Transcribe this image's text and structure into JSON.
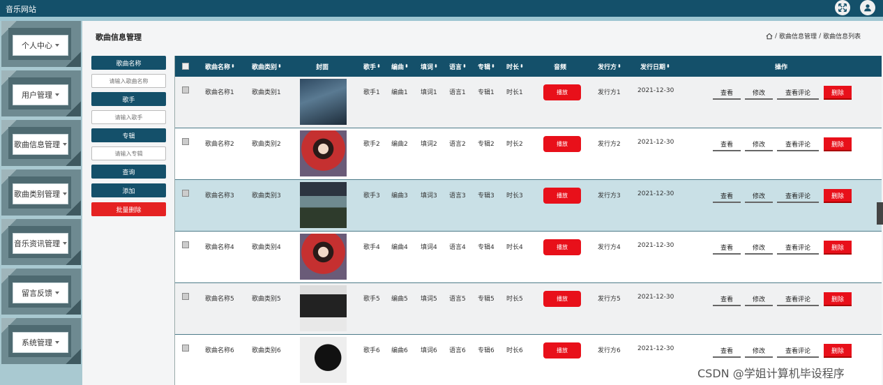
{
  "app": {
    "title": "音乐网站"
  },
  "sidebar": {
    "items": [
      {
        "label": "个人中心"
      },
      {
        "label": "用户管理"
      },
      {
        "label": "歌曲信息管理"
      },
      {
        "label": "歌曲类别管理"
      },
      {
        "label": "音乐资讯管理"
      },
      {
        "label": "留言反馈"
      },
      {
        "label": "系统管理"
      }
    ]
  },
  "page": {
    "title": "歌曲信息管理",
    "breadcrumb": {
      "section": "歌曲信息管理",
      "current": "歌曲信息列表",
      "sep": "/"
    }
  },
  "search": {
    "name_label": "歌曲名称",
    "name_placeholder": "请输入歌曲名称",
    "singer_label": "歌手",
    "singer_placeholder": "请输入歌手",
    "album_label": "专辑",
    "album_placeholder": "请输入专辑",
    "query_btn": "查询",
    "add_btn": "添加",
    "batch_delete_btn": "批量删除"
  },
  "table": {
    "headers": {
      "name": "歌曲名称",
      "category": "歌曲类别",
      "cover": "封面",
      "singer": "歌手",
      "composer": "编曲",
      "lyricist": "填词",
      "language": "语言",
      "album": "专辑",
      "duration": "时长",
      "audio": "音频",
      "publisher": "发行方",
      "date": "发行日期",
      "ops": "操作"
    },
    "sort_glyph": "⬍",
    "play_label": "播放",
    "view_label": "查看",
    "edit_label": "修改",
    "comments_label": "查看评论",
    "delete_label": "删除",
    "rows": [
      {
        "name": "歌曲名称1",
        "category": "歌曲类别1",
        "singer": "歌手1",
        "composer": "编曲1",
        "lyricist": "填词1",
        "language": "语言1",
        "album": "专辑1",
        "duration": "时长1",
        "publisher": "发行方1",
        "date": "2021-12-30",
        "cover_text": ""
      },
      {
        "name": "歌曲名称2",
        "category": "歌曲类别2",
        "singer": "歌手2",
        "composer": "编曲2",
        "lyricist": "填词2",
        "language": "语言2",
        "album": "专辑2",
        "duration": "时长2",
        "publisher": "发行方2",
        "date": "2021-12-30",
        "cover_text": ""
      },
      {
        "name": "歌曲名称3",
        "category": "歌曲类别3",
        "singer": "歌手3",
        "composer": "编曲3",
        "lyricist": "填词3",
        "language": "语言3",
        "album": "专辑3",
        "duration": "时长3",
        "publisher": "发行方3",
        "date": "2021-12-30",
        "cover_text": ""
      },
      {
        "name": "歌曲名称4",
        "category": "歌曲类别4",
        "singer": "歌手4",
        "composer": "编曲4",
        "lyricist": "填词4",
        "language": "语言4",
        "album": "专辑4",
        "duration": "时长4",
        "publisher": "发行方4",
        "date": "2021-12-30",
        "cover_text": ""
      },
      {
        "name": "歌曲名称5",
        "category": "歌曲类别5",
        "singer": "歌手5",
        "composer": "编曲5",
        "lyricist": "填词5",
        "language": "语言5",
        "album": "专辑5",
        "duration": "时长5",
        "publisher": "发行方5",
        "date": "2021-12-30",
        "cover_text": ""
      },
      {
        "name": "歌曲名称6",
        "category": "歌曲类别6",
        "singer": "歌手6",
        "composer": "编曲6",
        "lyricist": "填词6",
        "language": "语言6",
        "album": "专辑6",
        "duration": "时长6",
        "publisher": "发行方6",
        "date": "2021-12-30",
        "cover_text": ""
      }
    ]
  },
  "watermark": "CSDN @学姐计算机毕设程序",
  "colors": {
    "header": "#14506a",
    "danger": "#e8101a",
    "sidebar": "#a9c9d1"
  }
}
